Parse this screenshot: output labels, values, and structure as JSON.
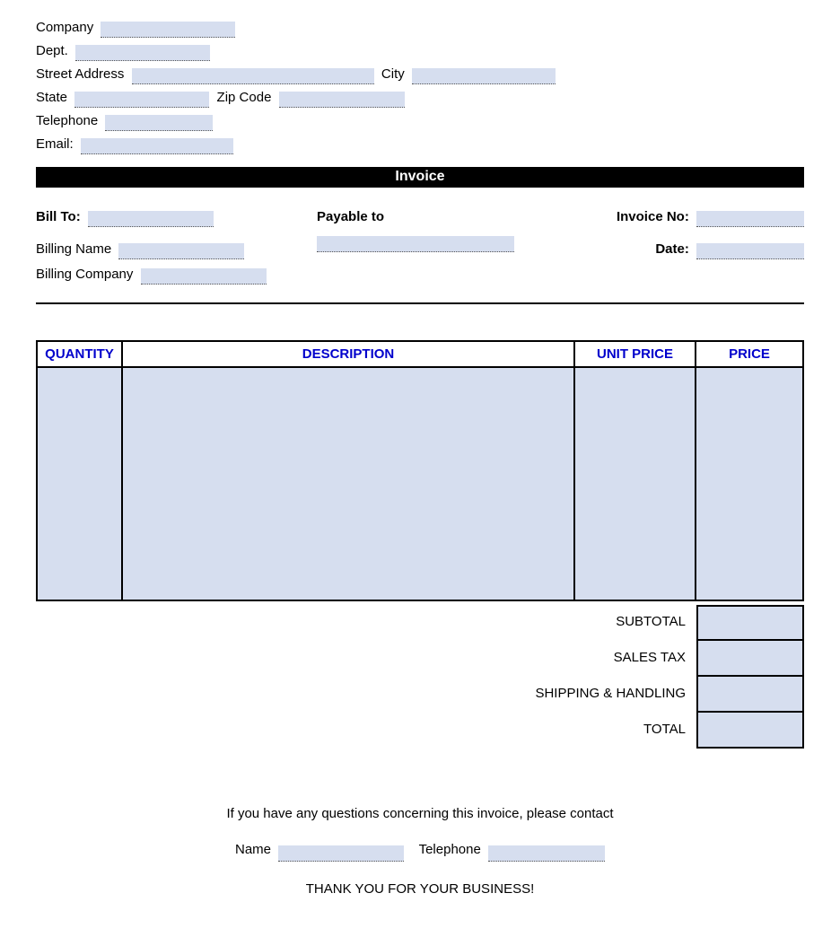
{
  "header": {
    "company_label": "Company",
    "dept_label": "Dept.",
    "street_label": "Street Address",
    "city_label": "City",
    "state_label": "State",
    "zip_label": "Zip Code",
    "telephone_label": "Telephone",
    "email_label": "Email:"
  },
  "title": "Invoice",
  "billto": {
    "billto_label": "Bill To:",
    "billing_name_label": "Billing Name",
    "billing_company_label": "Billing Company"
  },
  "payable_label": "Payable to",
  "meta": {
    "invoice_no_label": "Invoice No:",
    "date_label": "Date:"
  },
  "columns": {
    "qty": "QUANTITY",
    "desc": "DESCRIPTION",
    "unit": "UNIT PRICE",
    "price": "PRICE"
  },
  "totals": {
    "subtotal": "SUBTOTAL",
    "tax": "SALES TAX",
    "shipping": "SHIPPING & HANDLING",
    "total": "TOTAL"
  },
  "footer": {
    "questions": "If you have any questions concerning this invoice, please contact",
    "name_label": "Name",
    "telephone_label": "Telephone",
    "thanks": "THANK YOU FOR YOUR BUSINESS!"
  }
}
